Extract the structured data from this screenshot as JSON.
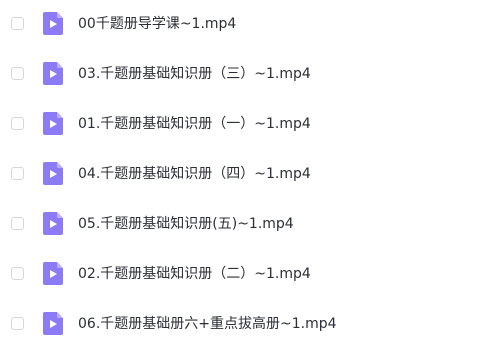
{
  "file_list": {
    "items": [
      {
        "name": "00千题册导学课~1.mp4",
        "icon": "video-file-icon",
        "checked": false
      },
      {
        "name": "03.千题册基础知识册（三）~1.mp4",
        "icon": "video-file-icon",
        "checked": false
      },
      {
        "name": "01.千题册基础知识册（一）~1.mp4",
        "icon": "video-file-icon",
        "checked": false
      },
      {
        "name": "04.千题册基础知识册（四）~1.mp4",
        "icon": "video-file-icon",
        "checked": false
      },
      {
        "name": "05.千题册基础知识册(五)~1.mp4",
        "icon": "video-file-icon",
        "checked": false
      },
      {
        "name": "02.千题册基础知识册（二）~1.mp4",
        "icon": "video-file-icon",
        "checked": false
      },
      {
        "name": "06.千题册基础册六+重点拔高册~1.mp4",
        "icon": "video-file-icon",
        "checked": false
      }
    ],
    "icon_color": "#8b7cf6",
    "icon_fold_color": "#b9afff"
  }
}
